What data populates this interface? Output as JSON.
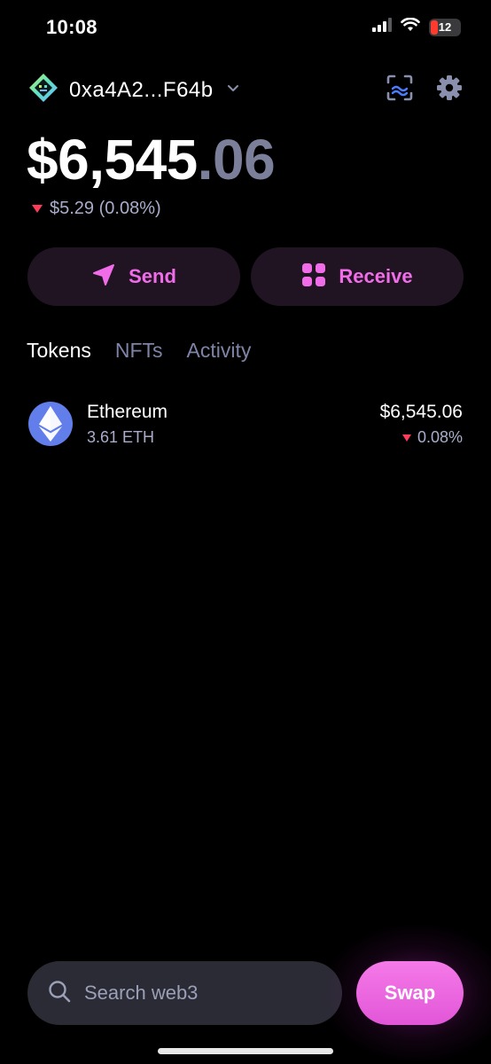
{
  "status_bar": {
    "time": "10:08",
    "battery": "12",
    "icons": [
      "cellular-signal-icon",
      "wifi-icon",
      "battery-icon"
    ]
  },
  "header": {
    "wallet_address": "0xa4A2...F64b",
    "icons": [
      "wallet-icon",
      "chevron-down-icon",
      "scan-icon",
      "gear-icon"
    ]
  },
  "balance": {
    "whole": "$6,545",
    "cents": ".06",
    "change_text": "$5.29 (0.08%)",
    "change_direction": "down"
  },
  "actions": {
    "send_label": "Send",
    "receive_label": "Receive"
  },
  "tabs": [
    {
      "label": "Tokens",
      "active": true
    },
    {
      "label": "NFTs",
      "active": false
    },
    {
      "label": "Activity",
      "active": false
    }
  ],
  "tokens": [
    {
      "name": "Ethereum",
      "amount": "3.61 ETH",
      "value": "$6,545.06",
      "change": "0.08%",
      "change_direction": "down",
      "icon": "ethereum-icon"
    }
  ],
  "bottom": {
    "search_placeholder": "Search web3",
    "swap_label": "Swap"
  },
  "colors": {
    "background": "#000000",
    "accent": "#f06ce8",
    "muted": "#7e84a8",
    "negative": "#ff3b5c",
    "eth": "#627eea"
  }
}
